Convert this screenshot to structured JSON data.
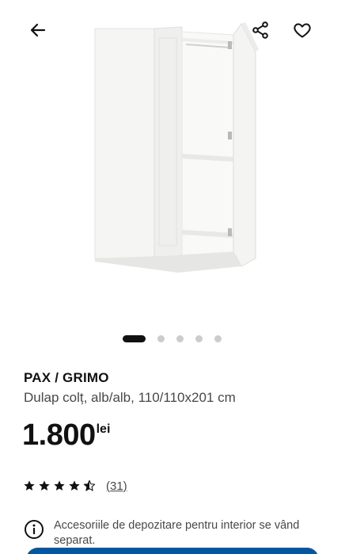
{
  "header": {
    "back_icon": "arrow-left-icon",
    "share_icon": "share-icon",
    "favorite_icon": "heart-outline-icon"
  },
  "gallery": {
    "total_images": 5,
    "active_index": 0
  },
  "product": {
    "name": "PAX / GRIMO",
    "description": "Dulap colț, alb/alb, 110/110x201 cm",
    "price": "1.800",
    "currency": "lei"
  },
  "rating": {
    "stars": 4.5,
    "max_stars": 5,
    "review_count": "(31)"
  },
  "notice": {
    "icon": "info-icon",
    "text": "Accesoriile de depozitare pentru interior se vând separat."
  },
  "colors": {
    "text_primary": "#111111",
    "text_secondary": "#484848",
    "dot_inactive": "#cccccc",
    "cta_blue": "#0058a3"
  }
}
